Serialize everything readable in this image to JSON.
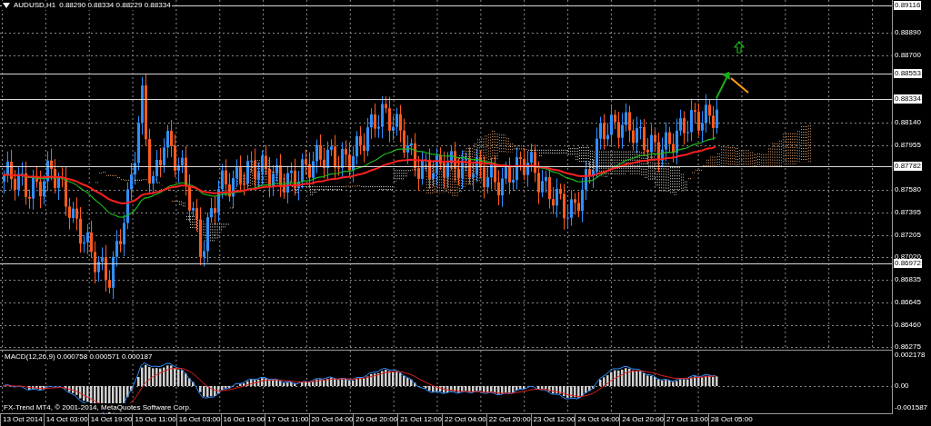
{
  "title": {
    "symbol": "AUDUSD,H1",
    "values": "0.88290 0.88334 0.88229 0.88334"
  },
  "price_axis": [
    {
      "label": "0.89116",
      "highlighted": true
    },
    {
      "label": "0.88890",
      "highlighted": false
    },
    {
      "label": "0.88700",
      "highlighted": false
    },
    {
      "label": "0.88553",
      "highlighted": true
    },
    {
      "label": "0.88334",
      "highlighted": true
    },
    {
      "label": "0.88140",
      "highlighted": false
    },
    {
      "label": "0.87955",
      "highlighted": false
    },
    {
      "label": "0.87782",
      "highlighted": true
    },
    {
      "label": "0.87580",
      "highlighted": false
    },
    {
      "label": "0.87395",
      "highlighted": false
    },
    {
      "label": "0.87205",
      "highlighted": false
    },
    {
      "label": "0.87020",
      "highlighted": false
    },
    {
      "label": "0.86972",
      "highlighted": true
    },
    {
      "label": "0.86835",
      "highlighted": false
    },
    {
      "label": "0.86645",
      "highlighted": false
    },
    {
      "label": "0.86460",
      "highlighted": false
    },
    {
      "label": "0.86275",
      "highlighted": false
    }
  ],
  "macd": {
    "title": "MACD(12,26,9) 0.000758 0.000571 0.000187",
    "axis": [
      "0.002178",
      "0.00",
      "-0.001587"
    ]
  },
  "copyright": "FX-Trend MT4, © 2001-2014, MetaQuotes Software Corp.",
  "time_axis": [
    "13 Oct 2014",
    "14 Oct 03:00",
    "14 Oct 19:00",
    "15 Oct 11:00",
    "16 Oct 03:00",
    "16 Oct 19:00",
    "17 Oct 11:00",
    "20 Oct 04:00",
    "20 Oct 20:00",
    "21 Oct 12:00",
    "22 Oct 04:00",
    "22 Oct 20:00",
    "23 Oct 12:00",
    "24 Oct 04:00",
    "24 Oct 20:00",
    "27 Oct 13:00",
    "28 Oct 05:00"
  ]
}
